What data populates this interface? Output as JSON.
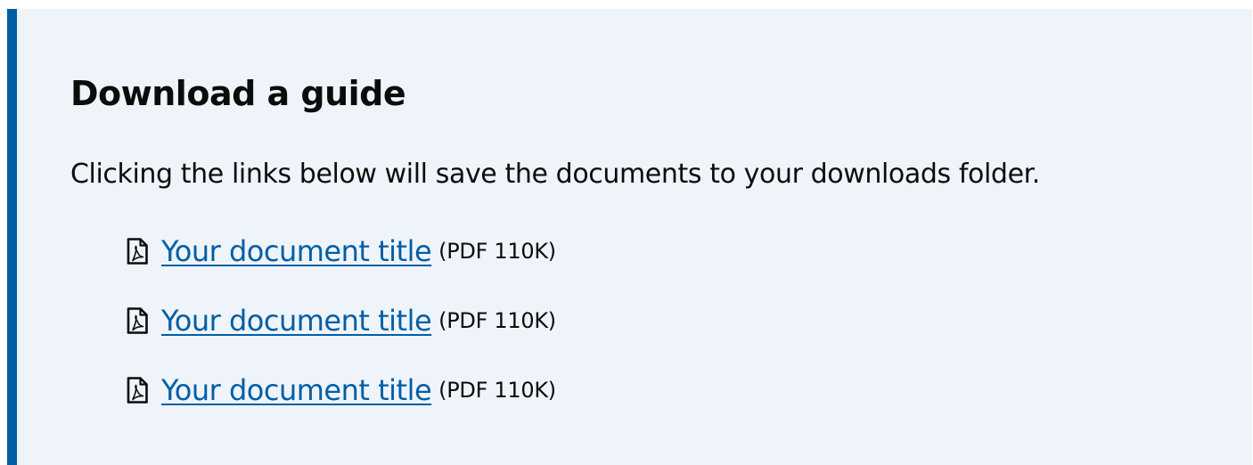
{
  "panel": {
    "heading": "Download a guide",
    "intro": "Clicking the links below will save the documents to your downloads folder.",
    "documents": [
      {
        "title": "Your document title",
        "meta": "(PDF 110K)",
        "icon": "pdf-file-icon"
      },
      {
        "title": "Your document title",
        "meta": "(PDF 110K)",
        "icon": "pdf-file-icon"
      },
      {
        "title": "Your document title",
        "meta": "(PDF 110K)",
        "icon": "pdf-file-icon"
      }
    ]
  },
  "colors": {
    "accent_border": "#005ea5",
    "panel_background": "#eff4fa",
    "link": "#005ea5",
    "text": "#0b0c0c"
  }
}
